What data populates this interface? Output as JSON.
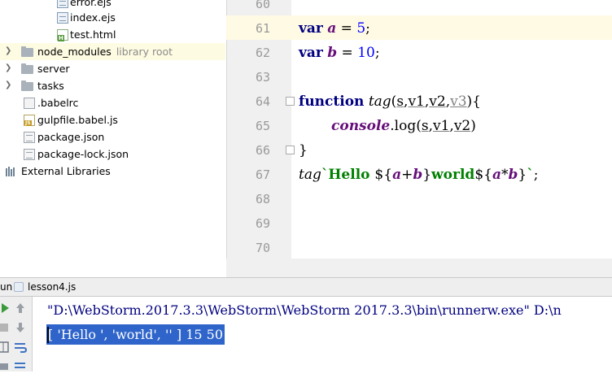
{
  "project_tree": {
    "items": [
      {
        "label": "error.ejs",
        "icon": "ejs-file-icon",
        "expander": ""
      },
      {
        "label": "index.ejs",
        "icon": "ejs-file-icon",
        "expander": ""
      },
      {
        "label": "test.html",
        "icon": "html-file-icon",
        "expander": ""
      },
      {
        "label": "node_modules",
        "hint": "library root",
        "icon": "folder-icon",
        "expander": "chevron-right-icon"
      },
      {
        "label": "server",
        "icon": "folder-icon",
        "expander": "chevron-right-icon"
      },
      {
        "label": "tasks",
        "icon": "folder-icon",
        "expander": "chevron-right-icon"
      },
      {
        "label": ".babelrc",
        "icon": "config-file-icon",
        "expander": ""
      },
      {
        "label": "gulpfile.babel.js",
        "icon": "js-file-icon",
        "expander": ""
      },
      {
        "label": "package.json",
        "icon": "json-file-icon",
        "expander": ""
      },
      {
        "label": "package-lock.json",
        "icon": "json-file-icon",
        "expander": ""
      },
      {
        "label": "External Libraries",
        "icon": "library-icon",
        "expander": ""
      }
    ]
  },
  "editor": {
    "line_numbers": [
      "60",
      "61",
      "62",
      "63",
      "64",
      "65",
      "66",
      "67",
      "68",
      "69",
      "70"
    ],
    "code": {
      "l61": {
        "kw": "var",
        "name": "a",
        "op": " = ",
        "num": "5",
        "end": ";"
      },
      "l62": {
        "kw": "var",
        "name": "b",
        "op": " = ",
        "num": "10",
        "end": ";"
      },
      "l64": {
        "kw": "function",
        "fn": "tag",
        "open": "(",
        "p1": "s",
        "c1": ",",
        "p2": "v1",
        "c2": ",",
        "p3": "v2",
        "c3": ",",
        "p4": "v3",
        "close": "){"
      },
      "l65": {
        "obj": "console",
        "dot": ".",
        "method": "log",
        "open": "(",
        "p1": "s",
        "c1": ",",
        "p2": "v1",
        "c2": ",",
        "p3": "v2",
        "close": ")"
      },
      "l66": {
        "text": "}"
      },
      "l67": {
        "fn": "tag",
        "tick": "`",
        "str1": "Hello ",
        "d1": "${",
        "a1": "a",
        "plus": "+",
        "b1": "b",
        "e1": "}",
        "str2": "world",
        "d2": "${",
        "a2": "a",
        "times": "*",
        "b2": "b",
        "e2": "}",
        "tick2": "`",
        "end": ";"
      }
    }
  },
  "run_panel": {
    "tab_label": "un",
    "config_name": "lesson4.js",
    "command": "\"D:\\WebStorm.2017.3.3\\WebStorm\\WebStorm 2017.3.3\\bin\\runnerw.exe\" D:\\n",
    "output": "[ 'Hello ', 'world', '' ] 15 50"
  },
  "colors": {
    "keyword": "#000080",
    "variable": "#660e7a",
    "number": "#0000ff",
    "template_string": "#008000",
    "selection": "#2f65ca",
    "current_line": "#fffae3"
  }
}
